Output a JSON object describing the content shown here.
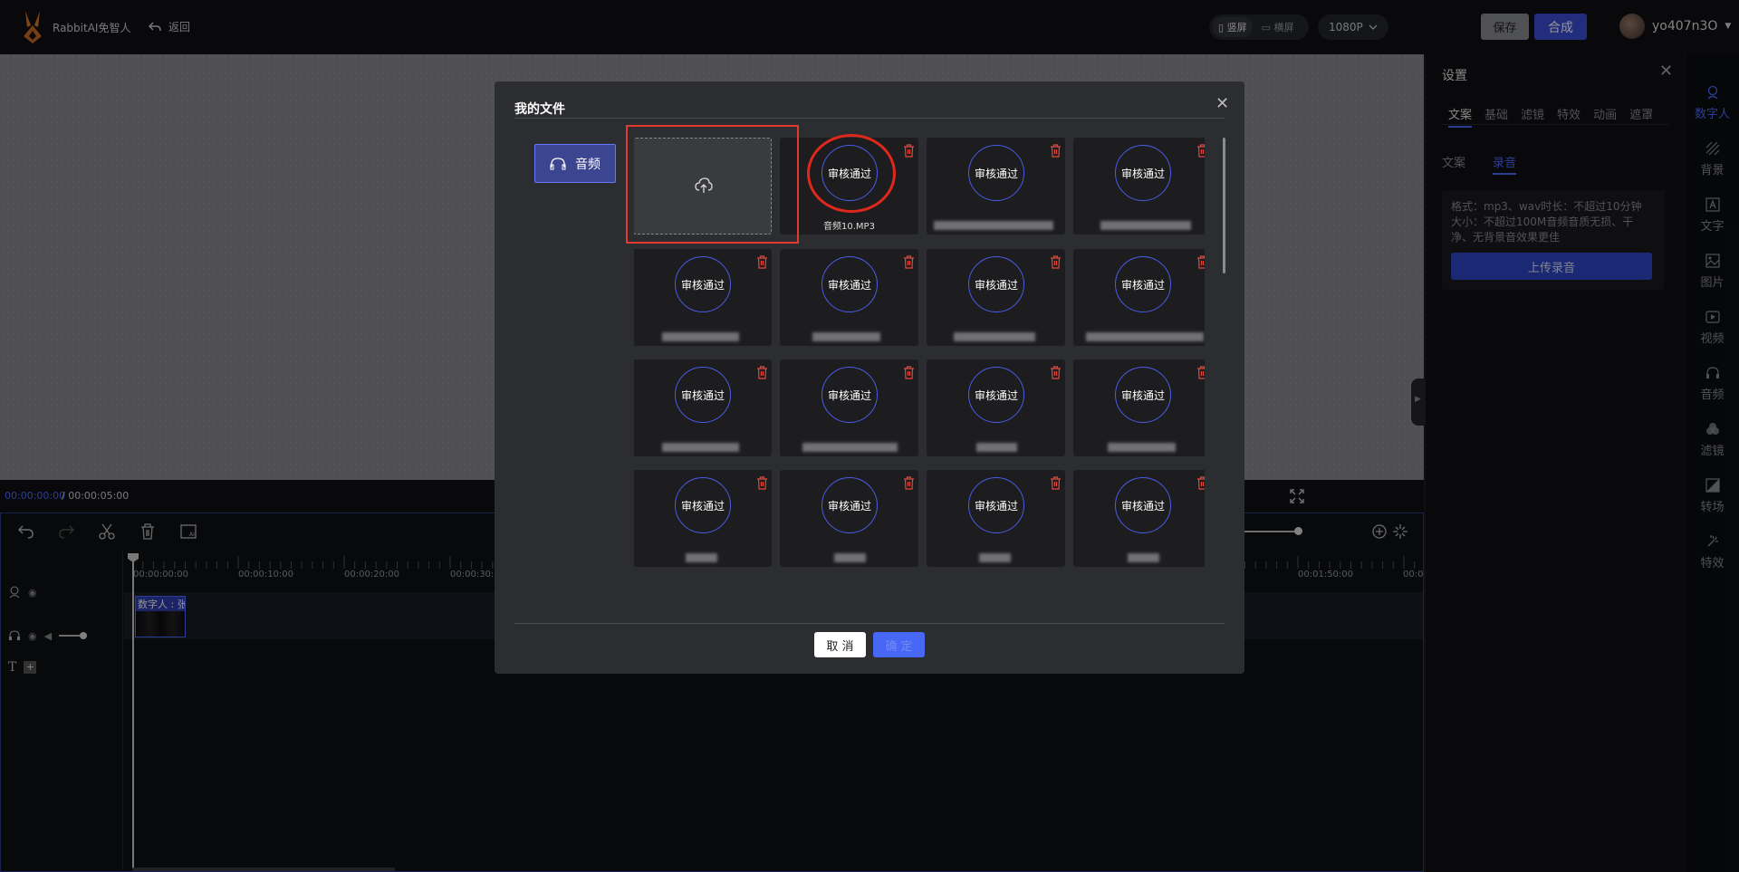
{
  "header": {
    "app_name": "RabbitAI免智人",
    "back_label": "返回",
    "orientation": {
      "portrait": "竖屏",
      "landscape": "横屏",
      "selected": "portrait"
    },
    "resolution": "1080P",
    "save_label": "保存",
    "compose_label": "合成",
    "username": "yo407n3O"
  },
  "player": {
    "current_time": "00:00:00:00",
    "total_time": "/ 00:00:05:00"
  },
  "timeline": {
    "ruler_labels": [
      "00:00:00:00",
      "00:00:10:00",
      "00:00:20:00",
      "00:00:30:0",
      "00:01:50:00",
      "00:0"
    ],
    "clip_label": "数字人 : 张"
  },
  "settings_panel": {
    "title": "设置",
    "tabs": [
      "文案",
      "基础",
      "滤镜",
      "特效",
      "动画",
      "遮罩"
    ],
    "active_tab": "文案",
    "subtabs": [
      "文案",
      "录音"
    ],
    "active_subtab": "录音",
    "info_lines": [
      "格式：mp3、wav时长：不超过10分钟",
      "大小：不超过100M音频音质无损、干",
      "净、无背景音效果更佳"
    ],
    "upload_label": "上传录音"
  },
  "sidebar": {
    "items": [
      {
        "label": "数字人",
        "icon": "digital-human-icon",
        "active": true
      },
      {
        "label": "背景",
        "icon": "background-icon"
      },
      {
        "label": "文字",
        "icon": "text-icon"
      },
      {
        "label": "图片",
        "icon": "image-icon"
      },
      {
        "label": "视频",
        "icon": "video-icon"
      },
      {
        "label": "音频",
        "icon": "audio-icon"
      },
      {
        "label": "滤镜",
        "icon": "filter-icon"
      },
      {
        "label": "转场",
        "icon": "transition-icon"
      },
      {
        "label": "特效",
        "icon": "effects-icon"
      }
    ]
  },
  "modal": {
    "title": "我的文件",
    "category_label": "音频",
    "status_label": "审核通过",
    "first_file_name": "音频10.MP3",
    "cancel_label": "取 消",
    "confirm_label": "确 定"
  },
  "colors": {
    "accent": "#4a6bff",
    "compose_button": "#3b4fd8",
    "highlight_red": "#e0271c",
    "delete_icon": "#e2483c"
  }
}
